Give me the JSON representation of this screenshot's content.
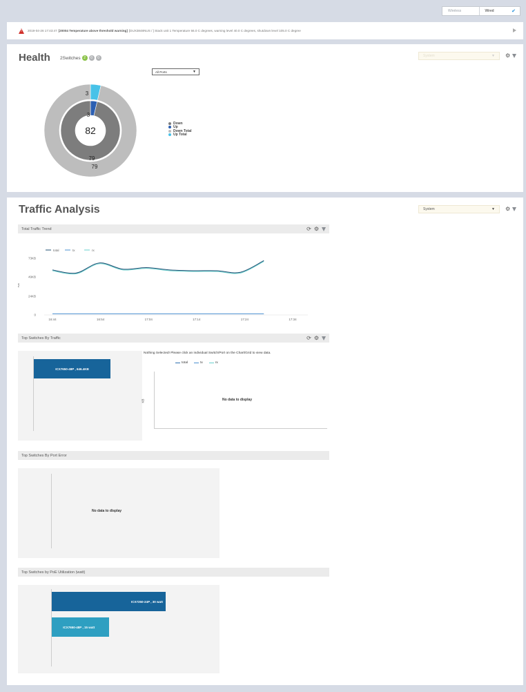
{
  "mode_toggle": {
    "wireless": "Wireless",
    "wired": "Wired"
  },
  "alert": {
    "timestamp": "2019-04-26 17:43:47",
    "title": "[20004 Temperature above threshold warning]",
    "message": "[DUX3848NUS / ] Stack unit 1 Temperature 56.0 C degrees, warning level 40.0 C degrees, shutdown level 105.0 C degree"
  },
  "health": {
    "title": "Health",
    "switches_label": "2Switches",
    "status_counts": [
      "2",
      "0",
      "0"
    ],
    "system_select": "System",
    "port_select": "All Ports",
    "donut": {
      "center_value": "82",
      "inner": {
        "down": 79,
        "up": 3
      },
      "outer": {
        "down_total": 79,
        "up_total": 3
      },
      "labels": {
        "outer_up": "3",
        "inner_up": "3",
        "inner_down": "79",
        "outer_down": "79"
      }
    },
    "legend": [
      {
        "label": "Down",
        "color": "#7d7d7d"
      },
      {
        "label": "Up",
        "color": "#2c5fb2"
      },
      {
        "label": "Down Total",
        "color": "#bdbdbd"
      },
      {
        "label": "Up Total",
        "color": "#48c2e8"
      }
    ]
  },
  "traffic": {
    "title": "Traffic Analysis",
    "system_select": "System",
    "total_trend": {
      "header": "Total Traffic Trend",
      "legend": [
        "total",
        "tx",
        "rx"
      ],
      "ylabel": "KB",
      "yticks": [
        "73KB",
        "49KB",
        "24KB",
        "0"
      ],
      "xticks": [
        "16:44",
        "16:54",
        "17:04",
        "17:14",
        "17:24",
        "17:34"
      ]
    },
    "top_by_traffic": {
      "header": "Top Switches By Traffic",
      "bar_label": "ICX7650-48P , 646.4KB",
      "nothing_selected": "Nothing Selected! Please click an individual Switch/Port on the Chart/Grid to view data.",
      "detail_legend": [
        "total",
        "tx",
        "rx"
      ],
      "detail_ylabel": "KB",
      "no_data": "No data to display"
    },
    "top_by_port_error": {
      "header": "Top Switches By Port Error",
      "no_data": "No data to display"
    },
    "top_by_poe": {
      "header": "Top Switches by PoE Utilization (watt)",
      "bars": [
        {
          "label": "ICX7250-24P , 30 watt",
          "value": 30,
          "color": "#17649a"
        },
        {
          "label": "ICX7650-48P , 15 watt",
          "value": 15,
          "color": "#2e9fc1"
        }
      ]
    }
  },
  "chart_data": {
    "type": "line",
    "title": "Total Traffic Trend",
    "ylabel": "KB",
    "x": [
      "16:44",
      "16:49",
      "16:54",
      "16:59",
      "17:04",
      "17:09",
      "17:14",
      "17:19",
      "17:24",
      "17:28"
    ],
    "ylim": [
      0,
      73
    ],
    "series": [
      {
        "name": "total",
        "values": [
          58,
          54,
          67,
          59,
          61,
          58,
          57,
          57,
          55,
          70
        ],
        "color": "#1f4f73"
      },
      {
        "name": "tx",
        "values": [
          1.5,
          1.5,
          1.5,
          1.5,
          1.5,
          1.5,
          1.5,
          1.5,
          1.5,
          1.5
        ],
        "color": "#4a90d0"
      },
      {
        "name": "rx",
        "values": [
          57,
          53,
          66,
          58,
          60,
          57,
          56,
          56,
          54,
          69
        ],
        "color": "#67d0cd"
      }
    ],
    "grid": false,
    "legend": "top-left"
  }
}
